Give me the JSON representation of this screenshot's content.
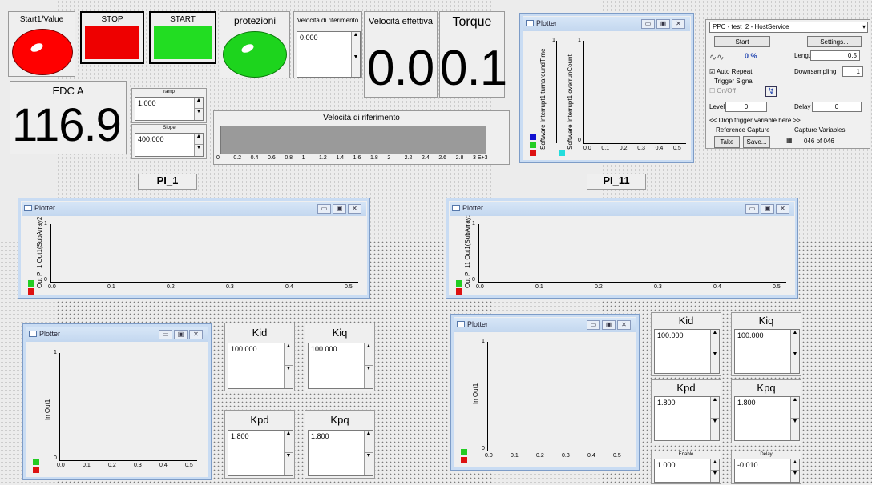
{
  "top": {
    "start_value": {
      "label": "Start1/Value"
    },
    "stop": {
      "label": "STOP",
      "color": "#ee0000"
    },
    "start": {
      "label": "START",
      "color": "#22dd22"
    },
    "protezioni": {
      "label": "protezioni"
    },
    "vel_rif": {
      "label": "Velocità di riferimento",
      "value": "0.000"
    },
    "vel_eff": {
      "label": "Velocità effettiva",
      "value": "0.0"
    },
    "torque": {
      "label": "Torque",
      "value": "0.1"
    },
    "edc": {
      "label": "EDC A",
      "value": "116.9"
    },
    "ramp": {
      "label": "ramp",
      "value": "1.000"
    },
    "slope": {
      "label": "Slope",
      "value": "400.000"
    },
    "slider": {
      "title": "Velocità di riferimento",
      "ticks": [
        "0",
        "0.2",
        "0.4",
        "0.6",
        "0.8",
        "1",
        "1.2",
        "1.4",
        "1.6",
        "1.8",
        "2",
        "2.2",
        "2.4",
        "2.6",
        "2.8",
        "3 E+3"
      ]
    }
  },
  "plotter_top": {
    "title": "Plotter",
    "ylabel1": "Software Interrupt1 turnaroundTime",
    "ylabel2": "Software Interrupt1 overrunCount",
    "ytop1": "1",
    "ytop2": "1",
    "yzero": "0",
    "xticks": [
      "0.0",
      "0.1",
      "0.2",
      "0.3",
      "0.4",
      "0.5"
    ]
  },
  "service": {
    "select": "PPC - test_2 - HostService",
    "start_btn": "Start",
    "settings_btn": "Settings...",
    "percent": "0 %",
    "length_label": "Length",
    "length_value": "0.5",
    "auto_repeat": "Auto Repeat",
    "downsampling_label": "Downsampling",
    "downsampling_value": "1",
    "trigger_signal": "Trigger Signal",
    "onoff": "On/Off",
    "level_label": "Level",
    "level_value": "0",
    "delay_label": "Delay",
    "delay_value": "0",
    "drop": "<< Drop trigger variable here >>",
    "ref_capture": "Reference Capture",
    "capture_vars": "Capture Variables",
    "take_btn": "Take",
    "save_btn": "Save...",
    "count": "046 of 046"
  },
  "pi1": {
    "label": "PI_1"
  },
  "pi11": {
    "label": "PI_11"
  },
  "plotter_pi1": {
    "title": "Plotter",
    "ylabel": "Out PI 1 Out1(SubArray2",
    "ytop": "1",
    "yzero": "0",
    "xticks": [
      "0.0",
      "0.1",
      "0.2",
      "0.3",
      "0.4",
      "0.5"
    ]
  },
  "plotter_pi11": {
    "title": "Plotter",
    "ylabel": "Out PI 11 Out1(SubArray:",
    "ytop": "1",
    "yzero": "0",
    "xticks": [
      "0.0",
      "0.1",
      "0.2",
      "0.3",
      "0.4",
      "0.5"
    ]
  },
  "plotter_in1": {
    "title": "Plotter",
    "ylabel": "In Out1",
    "ytop": "1",
    "yzero": "0",
    "xticks": [
      "0.0",
      "0.1",
      "0.2",
      "0.3",
      "0.4",
      "0.5"
    ]
  },
  "plotter_in1b": {
    "title": "Plotter",
    "ylabel": "In Out1",
    "ytop": "1",
    "yzero": "0",
    "xticks": [
      "0.0",
      "0.1",
      "0.2",
      "0.3",
      "0.4",
      "0.5"
    ]
  },
  "left_params": {
    "kid": {
      "label": "Kid",
      "value": "100.000"
    },
    "kiq": {
      "label": "Kiq",
      "value": "100.000"
    },
    "kpd": {
      "label": "Kpd",
      "value": "1.800"
    },
    "kpq": {
      "label": "Kpq",
      "value": "1.800"
    }
  },
  "right_params": {
    "kid": {
      "label": "Kid",
      "value": "100.000"
    },
    "kiq": {
      "label": "Kiq",
      "value": "100.000"
    },
    "kpd": {
      "label": "Kpd",
      "value": "1.800"
    },
    "kpq": {
      "label": "Kpq",
      "value": "1.800"
    },
    "enable": {
      "label": "Enable",
      "value": "1.000"
    },
    "delay": {
      "label": "Delay",
      "value": "-0.010"
    }
  }
}
